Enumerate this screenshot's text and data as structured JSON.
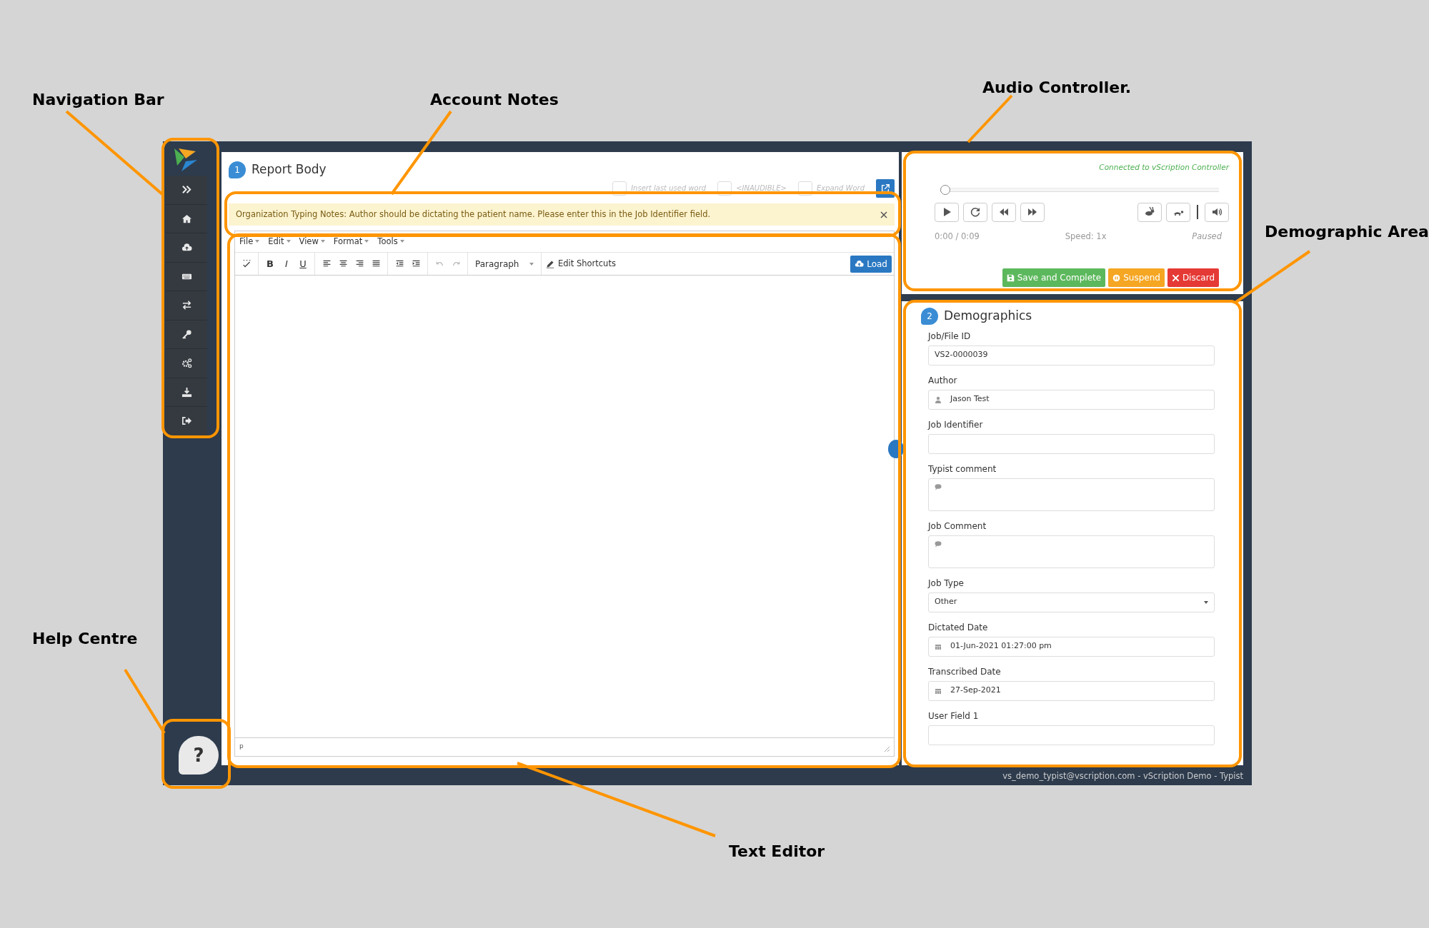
{
  "annotations": [
    {
      "label": "Navigation Bar"
    },
    {
      "label": "Account Notes"
    },
    {
      "label": "Audio Controller."
    },
    {
      "label": "Demographic Area"
    },
    {
      "label": "Help Centre"
    },
    {
      "label": "Text Editor"
    }
  ],
  "help_button": {
    "label": "?"
  },
  "report_body": {
    "badge": "1",
    "title": "Report Body",
    "shortcuts": [
      {
        "label": "Insert last used word"
      },
      {
        "label": "<INAUDIBLE>"
      },
      {
        "label": "Expand Word"
      }
    ],
    "notes": {
      "text": "Organization Typing Notes: Author should be dictating the patient name. Please enter this in the Job Identifier field."
    },
    "editor": {
      "menus": [
        "File",
        "Edit",
        "View",
        "Format",
        "Tools"
      ],
      "format_buttons": [
        "B",
        "I",
        "U"
      ],
      "block_format": "Paragraph",
      "shortcuts_button": "Edit Shortcuts",
      "load_button": "Load",
      "status_path": "p"
    }
  },
  "audio": {
    "status": "Connected to vScription Controller",
    "level": 0,
    "time": "0:00 / 0:09",
    "speed": "Speed: 1x",
    "state": "Paused",
    "buttons": [
      {
        "label": "Save and Complete",
        "kind": "save"
      },
      {
        "label": "Suspend",
        "kind": "suspend"
      },
      {
        "label": "Discard",
        "kind": "discard"
      }
    ]
  },
  "demographics": {
    "badge": "2",
    "title": "Demographics",
    "fields": [
      {
        "label": "Job/File ID",
        "kind": "text",
        "value": "VS2-0000039"
      },
      {
        "label": "Author",
        "kind": "person",
        "value": "Jason Test"
      },
      {
        "label": "Job Identifier",
        "kind": "text"
      },
      {
        "label": "Typist comment",
        "kind": "comment"
      },
      {
        "label": "Job Comment",
        "kind": "comment"
      },
      {
        "label": "Job Type",
        "kind": "select",
        "value": "Other"
      },
      {
        "label": "Dictated Date",
        "kind": "date",
        "value": "01-Jun-2021 01:27:00 pm"
      },
      {
        "label": "Transcribed Date",
        "kind": "date",
        "value": "27-Sep-2021"
      },
      {
        "label": "User Field 1",
        "kind": "text"
      }
    ]
  },
  "footer": "vs_demo_typist@vscription.com - vScription Demo - Typist"
}
